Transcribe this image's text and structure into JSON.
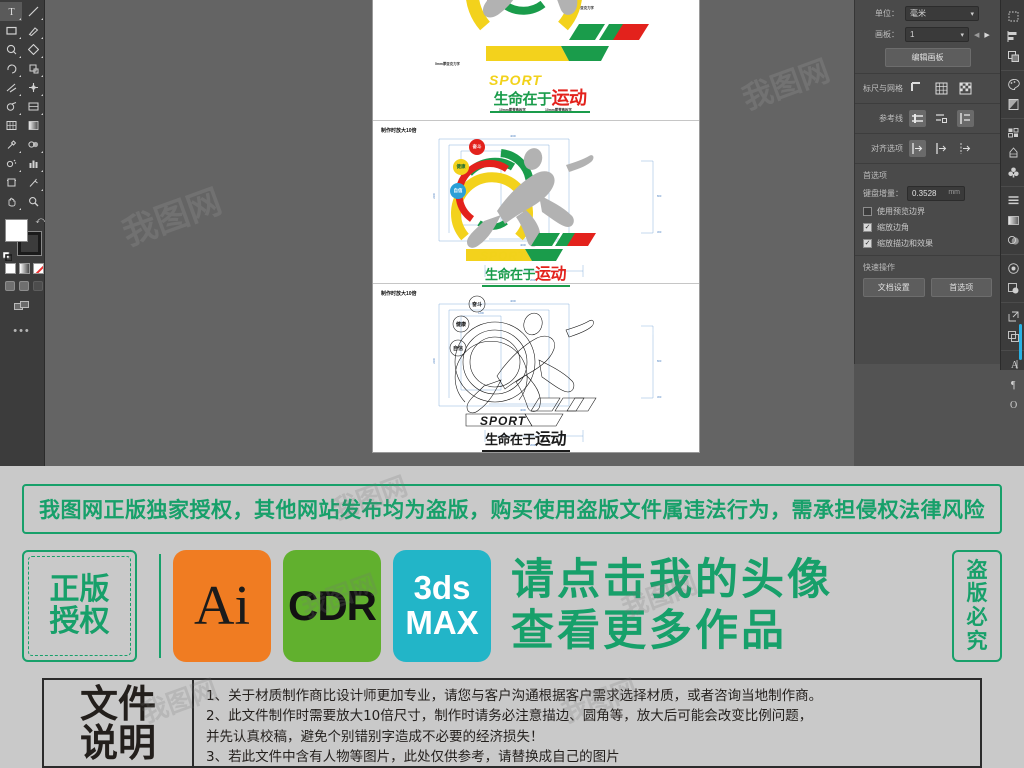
{
  "app": {
    "name": "Adobe Illustrator",
    "logo_text": "Ai"
  },
  "toolbar": {
    "tools": [
      {
        "name": "type-tool",
        "glyph": "T"
      },
      {
        "name": "line-segment-tool",
        "glyph": "/"
      },
      {
        "name": "rectangle-tool",
        "glyph": "▭"
      },
      {
        "name": "paintbrush-tool",
        "glyph": "✎"
      },
      {
        "name": "shaper-tool",
        "glyph": "◌"
      },
      {
        "name": "eraser-tool",
        "glyph": "◆"
      },
      {
        "name": "rotate-tool",
        "glyph": "↻"
      },
      {
        "name": "scale-tool",
        "glyph": "⊡"
      },
      {
        "name": "width-tool",
        "glyph": "✂"
      },
      {
        "name": "free-transform-tool",
        "glyph": "✣"
      },
      {
        "name": "shape-builder-tool",
        "glyph": "◍"
      },
      {
        "name": "perspective-grid-tool",
        "glyph": "▤"
      },
      {
        "name": "mesh-tool",
        "glyph": "▦"
      },
      {
        "name": "gradient-tool",
        "glyph": "▣"
      },
      {
        "name": "eyedropper-tool",
        "glyph": "✐"
      },
      {
        "name": "blend-tool",
        "glyph": "◑"
      },
      {
        "name": "symbol-sprayer-tool",
        "glyph": "✺"
      },
      {
        "name": "column-graph-tool",
        "glyph": "▥"
      },
      {
        "name": "artboard-tool",
        "glyph": "⌗"
      },
      {
        "name": "slice-tool",
        "glyph": "✂"
      },
      {
        "name": "hand-tool",
        "glyph": "✋"
      },
      {
        "name": "zoom-tool",
        "glyph": "🔍"
      }
    ],
    "fill_label": "fill-swatch",
    "stroke_label": "stroke-swatch",
    "fill_color": "#ffffff",
    "stroke_color": "#1b1b1b",
    "color_modes": [
      "solid-color",
      "gradient",
      "none"
    ],
    "screen_modes": [
      "normal-screen-mode",
      "full-screen-menu",
      "full-screen"
    ],
    "more_tools": "•••"
  },
  "properties_panel": {
    "document": {
      "unit_label": "单位：",
      "unit_value": "毫米",
      "artboard_label": "画板：",
      "artboard_value": "1",
      "edit_artboards_button": "编辑画板"
    },
    "rulers_grid": {
      "label": "标尺与网格",
      "buttons": [
        "show-rulers-icon",
        "show-grid-icon",
        "show-transparency-grid-icon"
      ]
    },
    "guides": {
      "label": "参考线",
      "buttons": [
        "show-guides-icon",
        "lock-guides-icon",
        "make-guides-icon"
      ]
    },
    "snap_options": {
      "label": "对齐选项",
      "buttons": [
        "smart-guides-icon",
        "snap-to-grid-icon",
        "snap-to-point-icon"
      ]
    },
    "preferences": {
      "section_title": "首选项",
      "keyboard_increment_label": "键盘增量：",
      "keyboard_increment_value": "0.3528",
      "keyboard_increment_unit": "mm",
      "checkboxes": [
        {
          "label": "使用预览边界",
          "checked": false
        },
        {
          "label": "缩放边角",
          "checked": true
        },
        {
          "label": "缩放描边和效果",
          "checked": true
        }
      ]
    },
    "quick_actions": {
      "section_title": "快速操作",
      "buttons": [
        "文档设置",
        "首选项"
      ]
    }
  },
  "dock": {
    "items": [
      {
        "name": "transform-panel-icon",
        "glyph": "⬚"
      },
      {
        "name": "align-panel-icon",
        "glyph": "▤"
      },
      {
        "name": "pathfinder-panel-icon",
        "glyph": "▧"
      },
      {
        "name": "color-panel-icon",
        "glyph": "◕"
      },
      {
        "name": "color-guide-panel-icon",
        "glyph": "◤"
      },
      {
        "name": "swatches-panel-icon",
        "glyph": "▩"
      },
      {
        "name": "brushes-panel-icon",
        "glyph": "♕"
      },
      {
        "name": "symbols-panel-icon",
        "glyph": "♣"
      },
      {
        "name": "stroke-panel-icon",
        "glyph": "≡"
      },
      {
        "name": "gradient-panel-icon",
        "glyph": "▤"
      },
      {
        "name": "transparency-panel-icon",
        "glyph": "◎"
      },
      {
        "name": "appearance-panel-icon",
        "glyph": "◉"
      },
      {
        "name": "graphic-styles-panel-icon",
        "glyph": "◳"
      },
      {
        "name": "links-panel-icon",
        "glyph": "⧉"
      },
      {
        "name": "layers-panel-icon",
        "glyph": "❏"
      },
      {
        "name": "character-panel-icon",
        "glyph": "A"
      },
      {
        "name": "paragraph-panel-icon",
        "glyph": "¶"
      },
      {
        "name": "opentype-panel-icon",
        "glyph": "O"
      }
    ]
  },
  "artwork": {
    "scale_note": "制作时放大10倍",
    "badges": [
      {
        "text": "奋斗",
        "color": "#e3221c"
      },
      {
        "text": "健康",
        "color": "#f3d21c"
      },
      {
        "text": "自信",
        "color": "#2a9fd6"
      }
    ],
    "title_en": "SPORT",
    "title_cn_1": "生命在于",
    "title_cn_2": "运动",
    "colors": {
      "yellow": "#f3d21c",
      "green": "#1a9c4b",
      "red": "#e3221c",
      "gray": "#b2b2b2",
      "blue": "#2a9fd6",
      "dim_blue": "#6d9fd6"
    },
    "dimension_labels": [
      "4000",
      "1200",
      "600",
      "400",
      "300",
      "800",
      "2200",
      "200"
    ],
    "callout_left": "5mm厚亚克力字",
    "callout_right": "5mm厚亚克力字",
    "callout_bottom_1": "10mm厚雪弗板字",
    "callout_bottom_2": "10mm厚雪弗板字"
  },
  "footer": {
    "banner": "我图网正版独家授权，其他网站发布均为盗版，购买使用盗版文件属违法行为，需承担侵权法律风险",
    "license_badge": {
      "line1": "正版",
      "line2": "授权"
    },
    "formats": [
      {
        "name": "format-ai",
        "label": "Ai",
        "color": "#f07c22"
      },
      {
        "name": "format-cdr",
        "label": "CDR",
        "color": "#61b02e"
      },
      {
        "name": "format-3dsmax",
        "label_top": "3ds",
        "label_bottom": "MAX",
        "color": "#22b5c8"
      }
    ],
    "cta_line1": "请点击我的头像",
    "cta_line2": "查看更多作品",
    "piracy_badge": {
      "l1": "盗",
      "l2": "版",
      "l3": "必",
      "l4": "究"
    },
    "description": {
      "title_line1": "文件",
      "title_line2": "说明",
      "items": [
        "1、关于材质制作商比设计师更加专业，请您与客户沟通根据客户需求选择材质，或者咨询当地制作商。",
        "2、此文件制作时需要放大10倍尺寸，制作时请务必注意描边、圆角等，放大后可能会改变比例问题，",
        "  并先认真校稿，避免个别错别字造成不必要的经济损失！",
        "3、若此文件中含有人物等图片，此处仅供参考，请替换成自己的图片"
      ]
    }
  },
  "watermark": {
    "text": "我图网"
  }
}
